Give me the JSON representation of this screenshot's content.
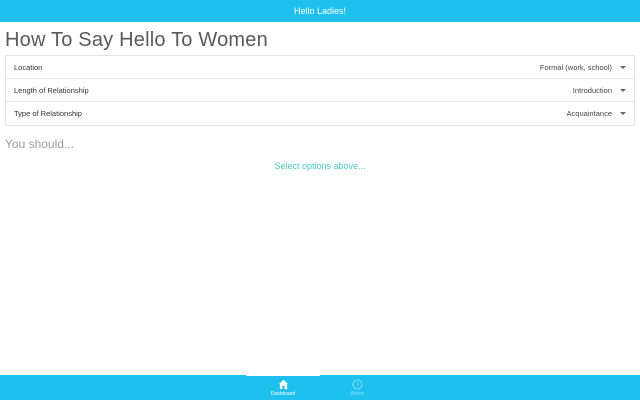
{
  "header": {
    "title": "Hello Ladies!"
  },
  "page": {
    "title": "How To Say Hello To Women"
  },
  "options": [
    {
      "label": "Location",
      "value": "Formal (work, school)"
    },
    {
      "label": "Length of Relationship",
      "value": "Introduction"
    },
    {
      "label": "Type of Relationship",
      "value": "Acquaintance"
    }
  ],
  "result": {
    "heading": "You should...",
    "placeholder": "Select options above..."
  },
  "tabbar": {
    "tabs": [
      {
        "label": "Dashboard",
        "icon": "home-icon",
        "active": true
      },
      {
        "label": "About",
        "icon": "info-icon",
        "active": false
      }
    ]
  },
  "colors": {
    "accent": "#1ec0ee",
    "result_text": "#4fc8c8"
  }
}
